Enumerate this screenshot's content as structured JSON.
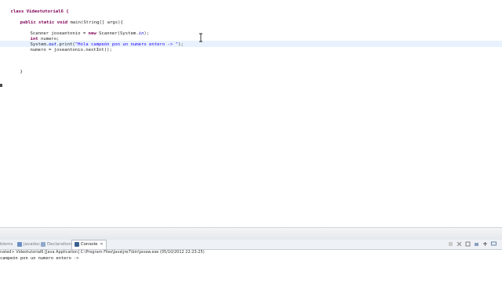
{
  "editor": {
    "code": {
      "l1": "class Videotutorial6 {",
      "l2_kw1": "public static void",
      "l2_rest": " main(String[] args){",
      "l3": "Scanner joseantonio = new Scanner(System.in);",
      "l3_a": "Scanner joseantonio = ",
      "l3_kw": "new",
      "l3_b": " Scanner(System.",
      "l3_fld": "in",
      "l3_c": ");",
      "l4_kw": "int",
      "l4_rest": " numero;",
      "l5_a": "System.",
      "l5_fld": "out",
      "l5_b": ".print(",
      "l5_str": "\"Hola campeón pon un numero entero -> \"",
      "l5_c": ");",
      "l6": "numero = joseantonio.nextInt();",
      "l7": "}"
    }
  },
  "bottom_panel": {
    "tabs": [
      {
        "label": "blems",
        "active": false
      },
      {
        "label": "Javadoc",
        "active": false
      },
      {
        "label": "Declaration",
        "active": false
      },
      {
        "label": "Console",
        "active": true
      }
    ],
    "console": {
      "terminated_label": "nated> Videotutorial6 [Java Application] C:\\Program Files\\Java\\jre7\\bin\\javaw.exe (05/10/2012 22:23:25)",
      "output": "campeón pon un numero entero ->"
    }
  },
  "colors": {
    "keyword": "#7f0055",
    "string": "#2a00ff",
    "field": "#0000c0",
    "current_line": "#e8f2fe"
  }
}
